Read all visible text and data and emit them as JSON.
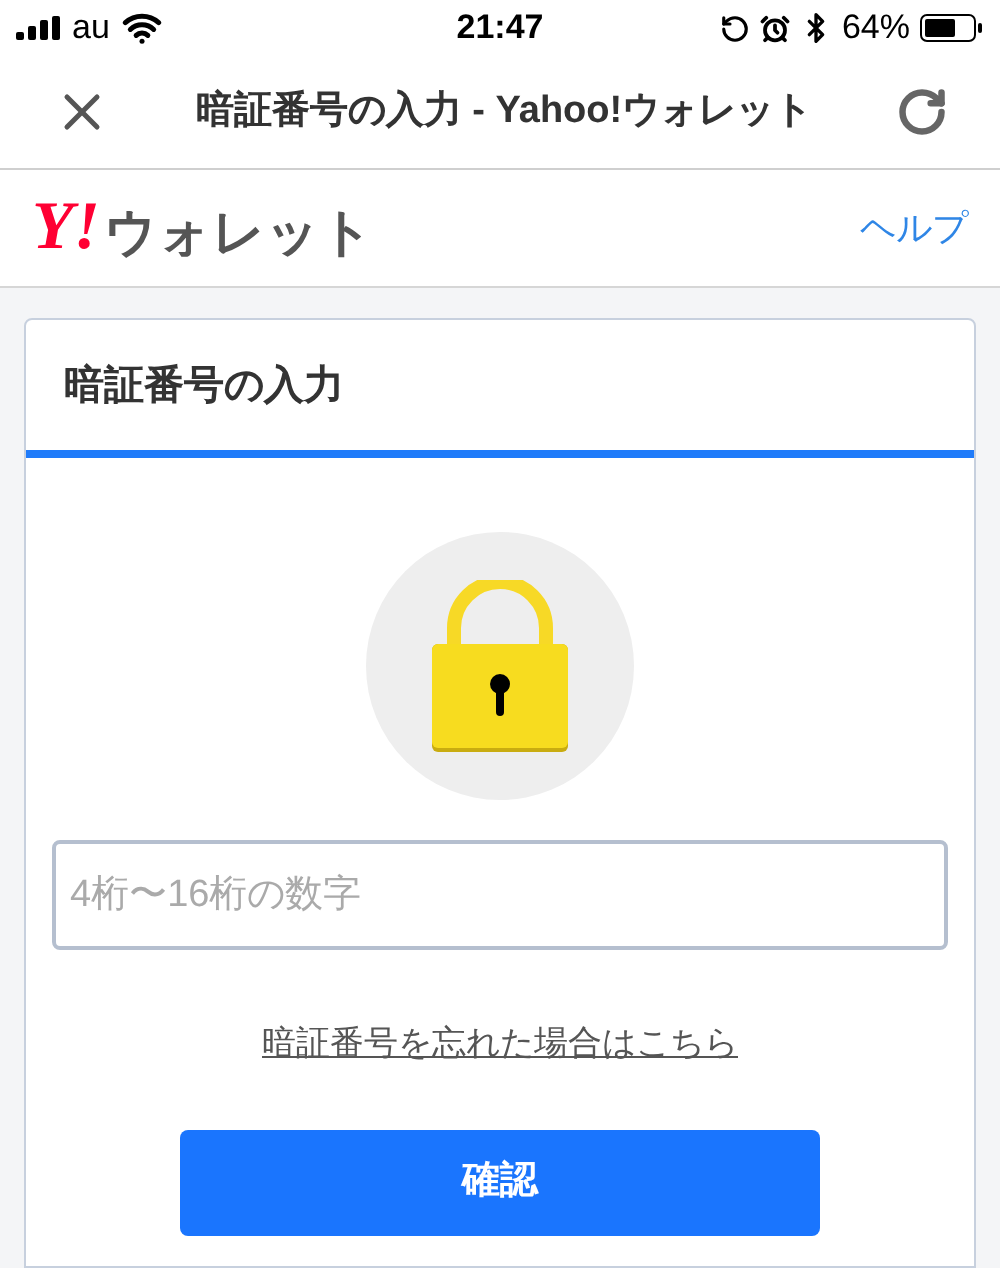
{
  "status_bar": {
    "carrier": "au",
    "time": "21:47",
    "battery": "64%"
  },
  "nav_bar": {
    "title": "暗証番号の入力 - Yahoo!ウォレット"
  },
  "header": {
    "logo_mark": "Y!",
    "logo_text": "ウォレット",
    "help_link": "ヘルプ"
  },
  "card": {
    "title": "暗証番号の入力",
    "pin_field": {
      "placeholder": "4桁〜16桁の数字"
    },
    "forgot_link": "暗証番号を忘れた場合はこちら",
    "confirm_button": "確認"
  }
}
